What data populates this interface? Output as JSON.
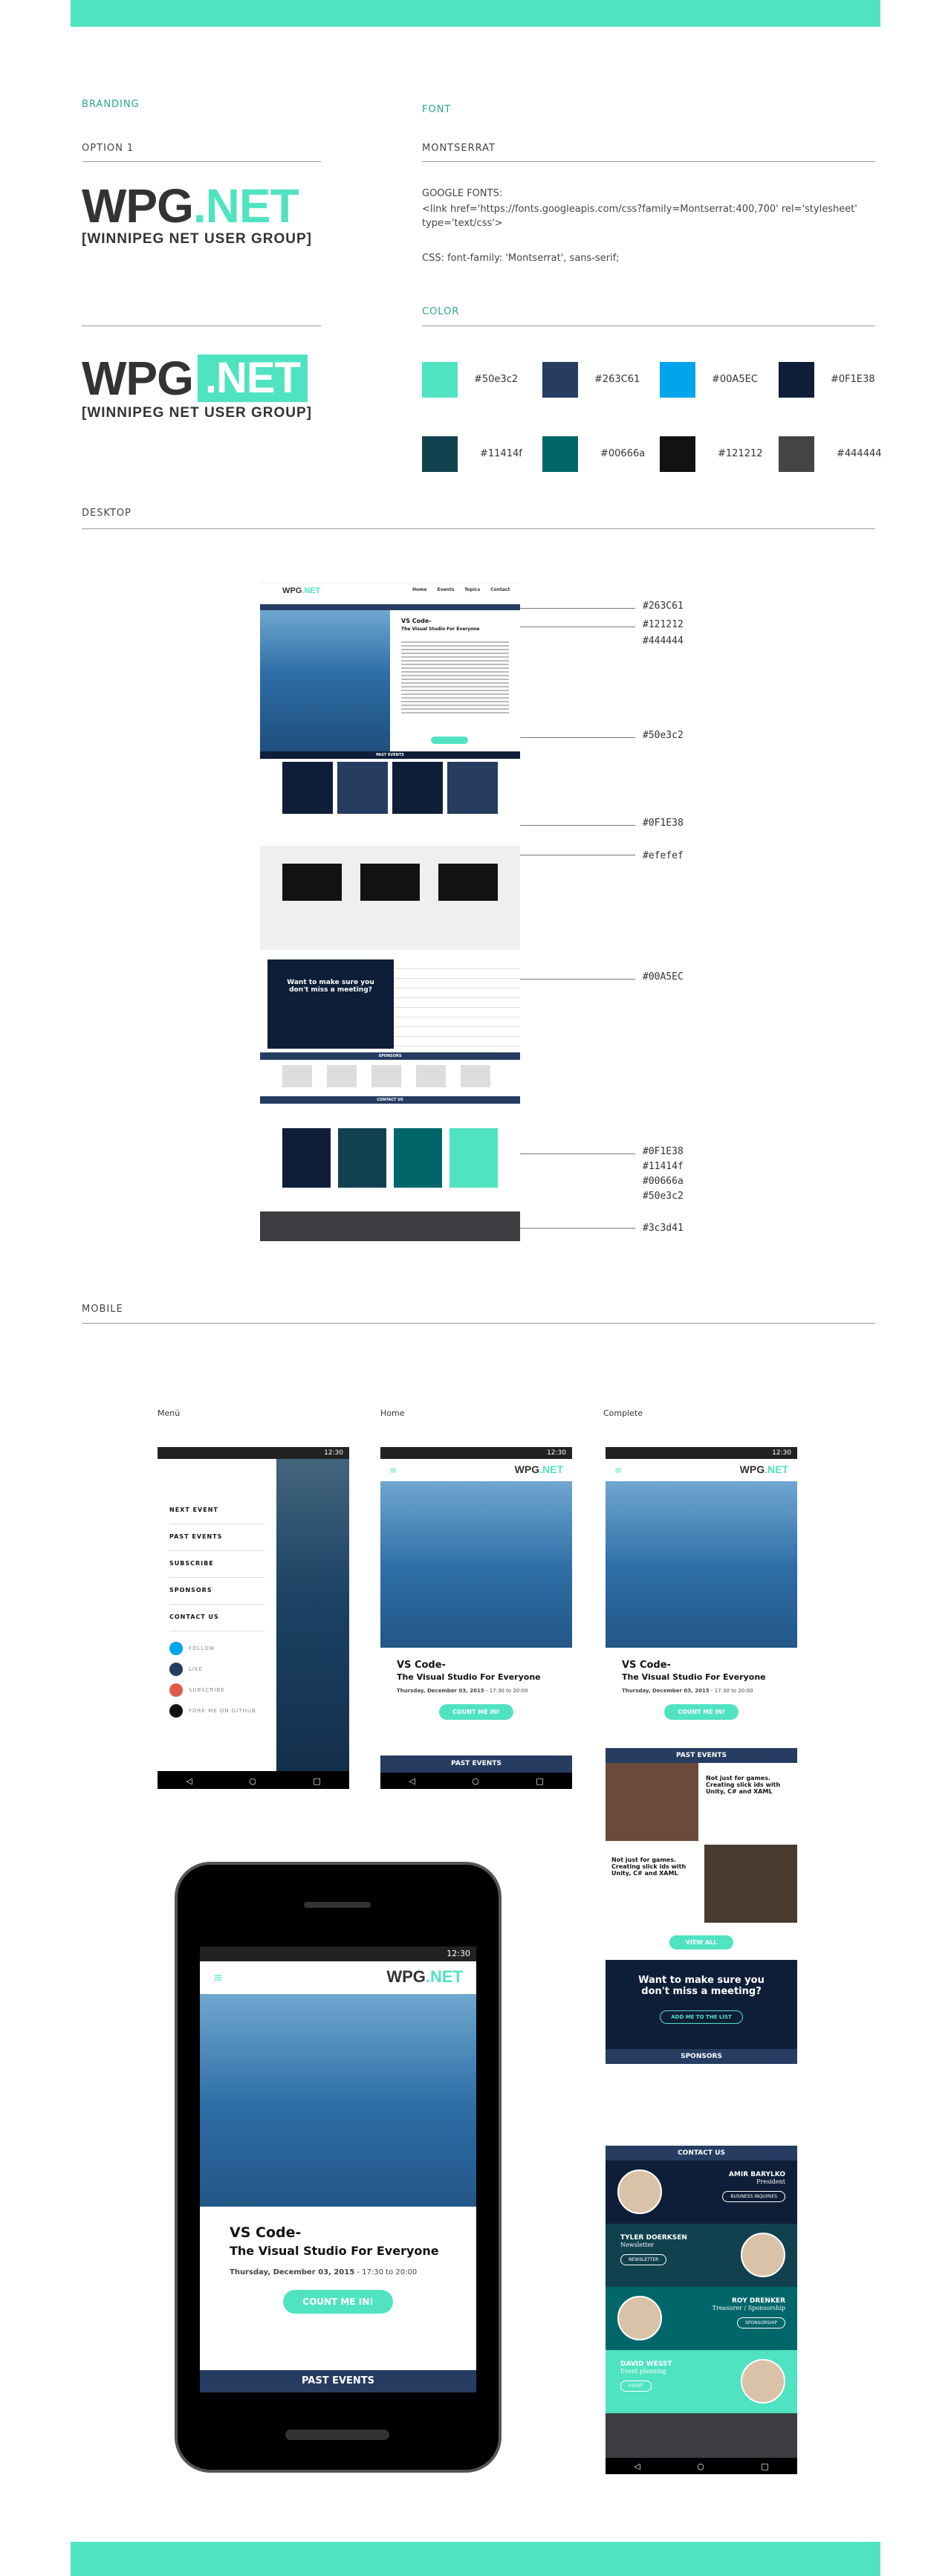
{
  "branding": {
    "section": "BRANDING",
    "option": "OPTION 1",
    "logo_main": "WPG",
    "logo_dot": ".NET",
    "logo_sub": "[WINNIPEG NET USER GROUP]"
  },
  "font": {
    "section": "FONT",
    "name": "MONTSERRAT",
    "google_label": "GOOGLE FONTS:",
    "google_link": "<link href='https://fonts.googleapis.com/css?family=Montserrat:400,700' rel='stylesheet' type='text/css'>",
    "css_rule": "CSS: font-family: 'Montserrat', sans-serif;"
  },
  "color": {
    "section": "COLOR",
    "swatches": [
      {
        "hex": "#50e3c2",
        "label": "#50e3c2"
      },
      {
        "hex": "#263C61",
        "label": "#263C61"
      },
      {
        "hex": "#00A5EC",
        "label": "#00A5EC"
      },
      {
        "hex": "#0F1E38",
        "label": "#0F1E38"
      },
      {
        "hex": "#11414f",
        "label": "#11414f"
      },
      {
        "hex": "#00666a",
        "label": "#00666a"
      },
      {
        "hex": "#121212",
        "label": "#121212"
      },
      {
        "hex": "#444444",
        "label": "#444444"
      }
    ]
  },
  "desktop": {
    "section": "DESKTOP",
    "annotations": [
      "#263C61",
      "#121212",
      "#444444",
      "#50e3c2",
      "#0F1E38",
      "#efefef",
      "#00A5EC",
      "#0F1E38",
      "#11414f",
      "#00666a",
      "#50e3c2",
      "#3c3d41"
    ],
    "nav": [
      "Home",
      "Events",
      "Topics",
      "Contact"
    ],
    "hero_title": "VS Code-",
    "hero_sub": "The Visual Studio For Everyone",
    "past_events": "PAST EVENTS",
    "sponsors": "SPONSORS",
    "contact": "CONTACT US",
    "meeting": "Want to make sure you don't miss a meeting?"
  },
  "mobile": {
    "section": "MOBILE",
    "labels": [
      "Menú",
      "Home",
      "Complete"
    ],
    "time": "12:30",
    "menu_items": [
      "NEXT EVENT",
      "PAST EVENTS",
      "SUBSCRIBE",
      "SPONSORS",
      "CONTACT US"
    ],
    "social": [
      "FOLLOW",
      "LIKE",
      "SUBSCRIBE",
      "FORK ME ON GITHUB"
    ],
    "event_title": "VS Code-",
    "event_sub": "The Visual Studio For Everyone",
    "event_date": "Thursday, December 03, 2015",
    "event_time": "- 17:30 to 20:00",
    "cta": "COUNT ME IN!",
    "past_events": "PAST EVENTS",
    "game_title": "Not just for games. Creating slick ids with Unity, C# and XAML",
    "view_all": "VIEW ALL",
    "meeting": "Want to make sure you don't miss a meeting?",
    "add_list": "ADD ME TO THE LIST",
    "sponsors": "SPONSORS",
    "contact": "CONTACT US",
    "people": [
      {
        "name": "AMIR BARYLKO",
        "role": "President",
        "btn": "BUSINESS INQUIRIES"
      },
      {
        "name": "TYLER DOERKSEN",
        "role": "Newsletter",
        "btn": "NEWSLETTER"
      },
      {
        "name": "ROY DRENKER",
        "role": "Treasurer / Sponsorship",
        "btn": "SPONSORSHIP"
      },
      {
        "name": "DAVID WESST",
        "role": "Event planning",
        "btn": "EVENT"
      }
    ]
  }
}
